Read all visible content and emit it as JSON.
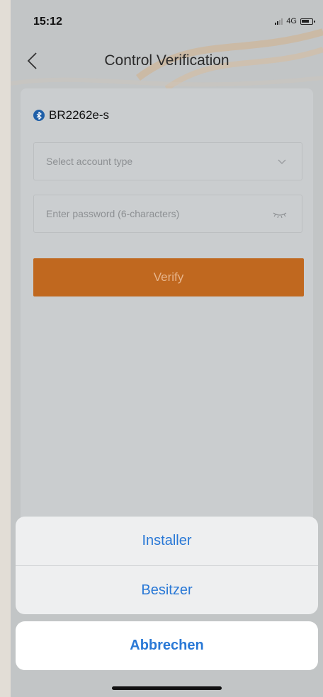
{
  "status_bar": {
    "time": "15:12",
    "network": "4G"
  },
  "nav": {
    "title": "Control Verification"
  },
  "device": {
    "name": "BR2262e-s"
  },
  "form": {
    "account_type_placeholder": "Select account type",
    "password_placeholder": "Enter password (6-characters)",
    "verify_label": "Verify"
  },
  "action_sheet": {
    "options": [
      {
        "label": "Installer"
      },
      {
        "label": "Besitzer"
      }
    ],
    "cancel_label": "Abbrechen"
  },
  "colors": {
    "accent": "#c0681f",
    "link": "#2978d6",
    "bluetooth": "#1f5fa8"
  }
}
